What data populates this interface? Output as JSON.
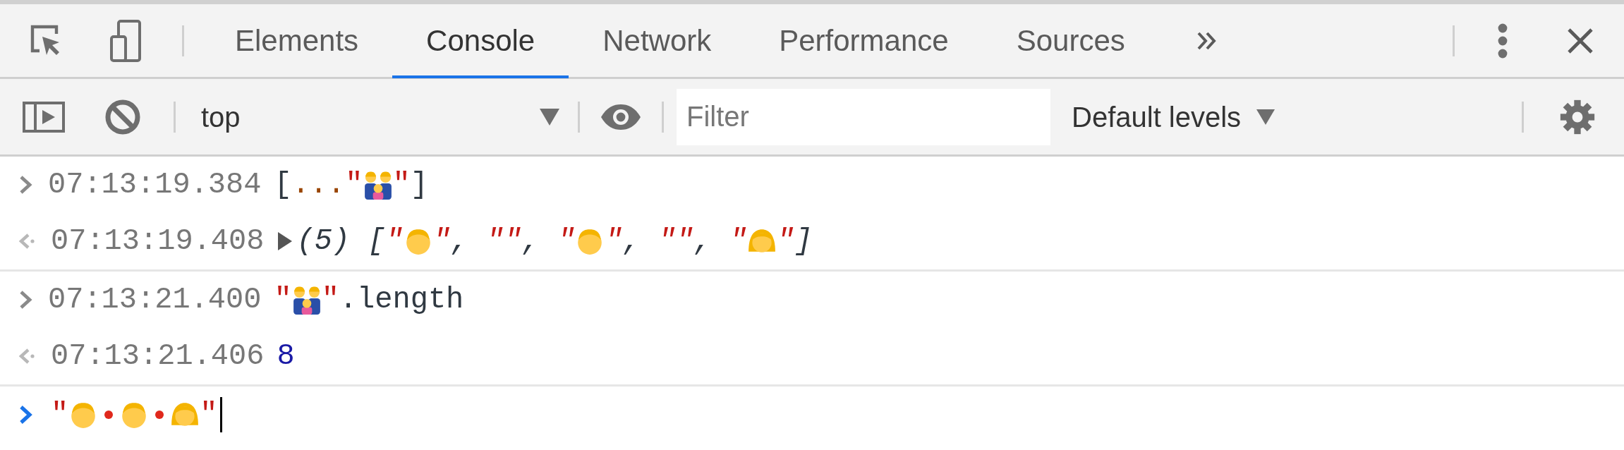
{
  "tabs": [
    {
      "label": "Elements",
      "selected": false
    },
    {
      "label": "Console",
      "selected": true
    },
    {
      "label": "Network",
      "selected": false
    },
    {
      "label": "Performance",
      "selected": false
    },
    {
      "label": "Sources",
      "selected": false
    }
  ],
  "toolbar": {
    "context": "top",
    "filter": {
      "placeholder": "Filter"
    },
    "levels": "Default levels"
  },
  "groups": [
    [
      {
        "kind": "input",
        "time": "07:13:19.384",
        "tokens": [
          {
            "kind": "punct",
            "text": "["
          },
          {
            "kind": "spread",
            "text": "..."
          },
          {
            "kind": "string",
            "text": "\""
          },
          {
            "kind": "family"
          },
          {
            "kind": "string",
            "text": "\""
          },
          {
            "kind": "punct",
            "text": "]"
          }
        ]
      },
      {
        "kind": "output",
        "time": "07:13:19.408",
        "expanded": false,
        "italic": true,
        "tokens": [
          {
            "kind": "punct",
            "text": "(5) ["
          },
          {
            "kind": "string",
            "text": "\""
          },
          {
            "kind": "man"
          },
          {
            "kind": "string",
            "text": "\""
          },
          {
            "kind": "punct",
            "text": ", "
          },
          {
            "kind": "string",
            "text": "\"\""
          },
          {
            "kind": "punct",
            "text": ", "
          },
          {
            "kind": "string",
            "text": "\""
          },
          {
            "kind": "man"
          },
          {
            "kind": "string",
            "text": "\""
          },
          {
            "kind": "punct",
            "text": ", "
          },
          {
            "kind": "string",
            "text": "\"\""
          },
          {
            "kind": "punct",
            "text": ", "
          },
          {
            "kind": "string",
            "text": "\""
          },
          {
            "kind": "girl"
          },
          {
            "kind": "string",
            "text": "\""
          },
          {
            "kind": "punct",
            "text": "]"
          }
        ]
      }
    ],
    [
      {
        "kind": "input",
        "time": "07:13:21.400",
        "tokens": [
          {
            "kind": "string",
            "text": "\""
          },
          {
            "kind": "family"
          },
          {
            "kind": "string",
            "text": "\""
          },
          {
            "kind": "punct",
            "text": ".length"
          }
        ]
      },
      {
        "kind": "output",
        "time": "07:13:21.406",
        "tokens": [
          {
            "kind": "number",
            "text": "8"
          }
        ]
      }
    ]
  ],
  "prompt": {
    "tokens": [
      {
        "kind": "string",
        "text": "\""
      },
      {
        "kind": "man"
      },
      {
        "kind": "joiner"
      },
      {
        "kind": "man"
      },
      {
        "kind": "joiner"
      },
      {
        "kind": "girl"
      },
      {
        "kind": "string",
        "text": "\""
      }
    ]
  }
}
